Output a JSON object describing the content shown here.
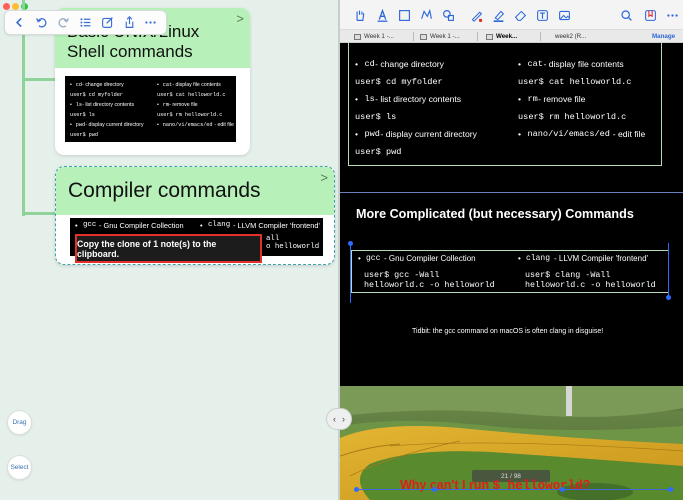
{
  "left_pane": {
    "toolbar_icons": [
      "back-icon",
      "undo-icon",
      "redo-icon",
      "outline-list-icon",
      "edit-note-icon",
      "share-icon",
      "more-icon"
    ],
    "card1": {
      "title": "Basic UNIX/Linux Shell commands",
      "slide": {
        "left_items": [
          {
            "code": "cd",
            "text": " - change directory"
          },
          {
            "code": "user$ cd myfolder",
            "text": ""
          },
          {
            "code": "ls",
            "text": " - list directory contents"
          },
          {
            "code": "user$ ls",
            "text": ""
          },
          {
            "code": "pwd",
            "text": " - display current directory"
          },
          {
            "code": "user$ pwd",
            "text": ""
          }
        ],
        "right_items": [
          {
            "code": "cat",
            "text": " - display file contents"
          },
          {
            "code": "user$ cat helloworld.c",
            "text": ""
          },
          {
            "code": "rm",
            "text": " - remove file"
          },
          {
            "code": "user$ rm helloworld.c",
            "text": ""
          },
          {
            "code": "nano/vi/emacs/ed",
            "text": " - edit file"
          }
        ]
      }
    },
    "card2": {
      "title": "Compiler commands",
      "slide": {
        "left_code": "gcc",
        "left_text": " - Gnu Compiler Collection",
        "right_code": "clang",
        "right_text": " - LLVM Compiler 'frontend'",
        "right_line2": "all",
        "right_line3": "o helloworld"
      }
    },
    "toast": "Copy the clone of 1 note(s) to the clipboard.",
    "drag_label": "Drag",
    "select_label": "Select"
  },
  "right_pane": {
    "toolbar_icons": [
      "hand-tool-icon",
      "text-tool-icon",
      "rect-select-icon",
      "lasso-icon",
      "shapes-icon",
      "pen-icon",
      "highlighter-icon",
      "eraser-icon",
      "text-box-icon",
      "image-icon",
      "search-icon",
      "bookmark-icon",
      "more-icon"
    ],
    "tabs": [
      {
        "label": "Week 1 -...",
        "active": false
      },
      {
        "label": "Week 1 -...",
        "active": false
      },
      {
        "label": "Week...",
        "active": true
      },
      {
        "label": "week2 (R...",
        "active": false
      }
    ],
    "manage_label": "Manage",
    "slide_upper": {
      "left": [
        {
          "code": "cd",
          "text": " - change directory"
        },
        {
          "code": "user$ cd myfolder",
          "text": ""
        },
        {
          "code": "ls",
          "text": " - list directory contents"
        },
        {
          "code": "user$ ls",
          "text": ""
        },
        {
          "code": "pwd",
          "text": " - display current directory"
        },
        {
          "code": "user$ pwd",
          "text": ""
        }
      ],
      "right": [
        {
          "code": "cat",
          "text": " - display file contents"
        },
        {
          "code": "user$ cat helloworld.c",
          "text": ""
        },
        {
          "code": "rm",
          "text": " - remove file"
        },
        {
          "code": "user$ rm helloworld.c",
          "text": ""
        },
        {
          "code": "nano/vi/emacs/ed",
          "text": " - edit file"
        }
      ]
    },
    "slide_lower": {
      "title": "More Complicated (but necessary) Commands",
      "gcc_code": "gcc",
      "gcc_text": " - Gnu Compiler Collection",
      "gcc_cmd1": "user$ gcc -Wall",
      "gcc_cmd2": "helloworld.c -o helloworld",
      "clang_code": "clang",
      "clang_text": " - LLVM Compiler 'frontend'",
      "clang_cmd1": "user$ clang -Wall",
      "clang_cmd2": "helloworld.c -o helloworld",
      "tidbit": "Tidbit: the gcc command on macOS is often clang in disguise!",
      "caption_prefix": "Why can't I run ",
      "caption_code": "$ helloworld",
      "caption_suffix": "?",
      "page_indicator": "21 / 98"
    }
  }
}
